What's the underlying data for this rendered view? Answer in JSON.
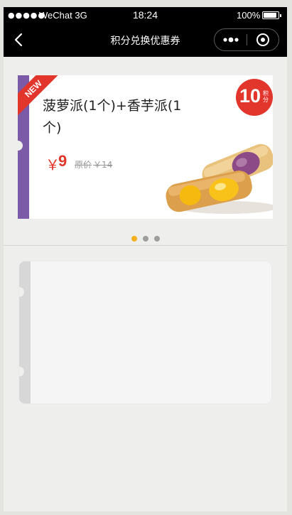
{
  "status_bar": {
    "signal": "●●●●●",
    "carrier": "WeChat 3G",
    "time": "18:24",
    "battery_percent": "100%"
  },
  "nav": {
    "title": "积分兑换优惠券",
    "back_icon": "chevron-left-icon",
    "more_icon": "more-dots-icon",
    "close_icon": "target-circle-icon"
  },
  "coupon": {
    "ribbon": "NEW",
    "name": "菠萝派(1个)+香芋派(1个)",
    "price_symbol": "￥",
    "price": "9",
    "original_label": "原价",
    "original_price": "￥14",
    "points": "10",
    "points_unit": "积分",
    "accent_color": "#e2352b",
    "stripe_color": "#7b5aa8"
  },
  "carousel": {
    "page_count": 3,
    "active_index": 0,
    "active_color": "#f5b11e"
  }
}
